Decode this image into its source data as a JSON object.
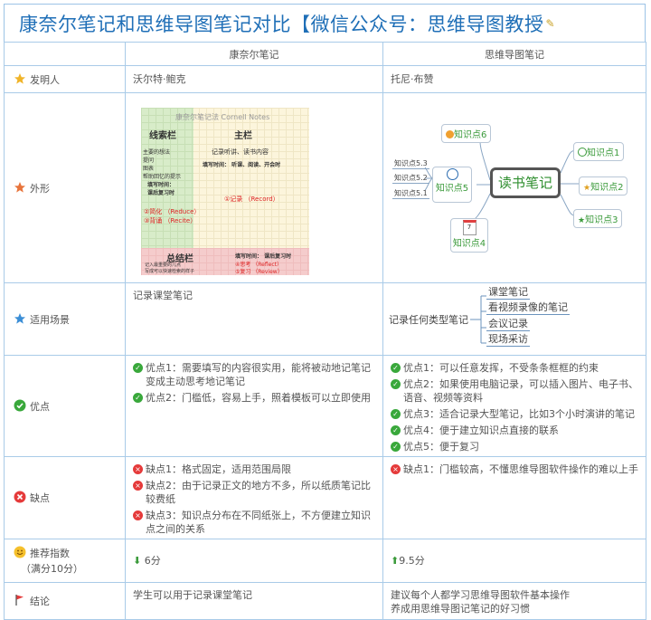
{
  "title": "康奈尔笔记和思维导图笔记对比【微信公众号：思维导图教授",
  "header": {
    "col_cornell": "康奈尔笔记",
    "col_mindmap": "思维导图笔记"
  },
  "rows": {
    "inventor": {
      "label": "发明人",
      "cornell": "沃尔特·鲍克",
      "mindmap": "托尼·布赞"
    },
    "appearance": {
      "label": "外形"
    },
    "scene": {
      "label": "适用场景",
      "cornell": "记录课堂笔记",
      "mindmap_root": "记录任何类型笔记",
      "mindmap_items": [
        "课堂笔记",
        "看视频录像的笔记",
        "会议记录",
        "现场采访"
      ]
    },
    "pros": {
      "label": "优点",
      "cornell": [
        "优点1：需要填写的内容很实用，能将被动地记笔记变成主动思考地记笔记",
        "优点2：门槛低，容易上手，照着模板可以立即使用"
      ],
      "mindmap": [
        "优点1：可以任意发挥，不受条条框框的约束",
        "优点2：如果使用电脑记录，可以插入图片、电子书、语音、视频等资料",
        "优点3：适合记录大型笔记，比如3个小时演讲的笔记",
        "优点4：便于建立知识点直接的联系",
        "优点5：便于复习"
      ]
    },
    "cons": {
      "label": "缺点",
      "cornell": [
        "缺点1：格式固定，适用范围局限",
        "缺点2：由于记录正文的地方不多，所以纸质笔记比较费纸",
        "缺点3：知识点分布在不同纸张上，不方便建立知识点之间的关系"
      ],
      "mindmap": [
        "缺点1：门槛较高，不懂思维导图软件操作的难以上手"
      ]
    },
    "rating": {
      "label": "推荐指数",
      "label2": "（满分10分）",
      "cornell": "6分",
      "mindmap": "9.5分"
    },
    "conclusion": {
      "label": "结论",
      "cornell": "学生可以用于记录课堂笔记",
      "mindmap": [
        "建议每个人都学习思维导图软件基本操作",
        "养成用思维导图记笔记的好习惯"
      ]
    }
  },
  "cornell_image": {
    "heading": "康奈尔笔记法 Cornell Notes",
    "cue_title": "线索栏",
    "main_title": "主栏",
    "cue_items": [
      "主要的想法",
      "提问",
      "图表",
      "帮助回忆的提示"
    ],
    "fill_time": "填写时间：",
    "after_class": "课后复习时",
    "reduce": "②简化 （Reduce）",
    "recite": "③背诵 （Recite）",
    "main_note": "记录听讲、读书内容",
    "main_time": "填写时间：  听课、阅读、开会时",
    "record": "①记录 （Record）",
    "summary_title": "总结栏",
    "summary_items": [
      "记入最重要的几点",
      "写成可以快速检索的样子"
    ],
    "summary_time": "填写时间：   课后复习时",
    "reflect": "④思考 （Reflect）",
    "review": "⑤复习 （Review）"
  },
  "mindmap_image": {
    "center": "读书笔记",
    "nodes": [
      "知识点1",
      "知识点2",
      "知识点3",
      "知识点4",
      "知识点5",
      "知识点6"
    ],
    "leaves": [
      "知识点5.3",
      "知识点5.2",
      "知识点5.1"
    ],
    "calendar_day": "7"
  }
}
